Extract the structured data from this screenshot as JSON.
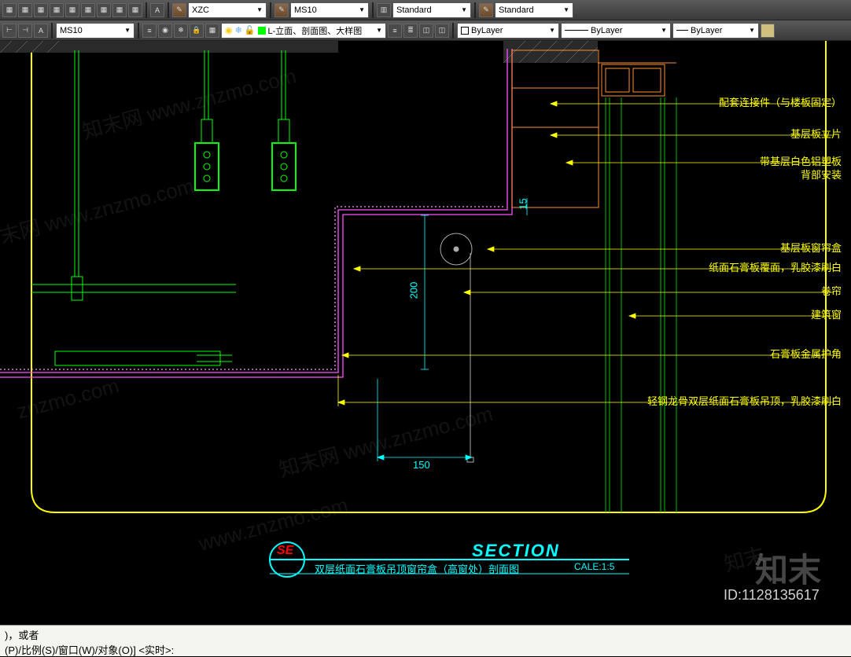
{
  "toolbar1": {
    "dropdowns": {
      "style1": "XZC",
      "style2": "MS10",
      "style3": "Standard",
      "style4": "Standard"
    }
  },
  "toolbar2": {
    "dropdowns": {
      "textstyle": "MS10",
      "layer": "L-立面、剖面图、大样图",
      "color": "ByLayer",
      "linetype": "ByLayer",
      "lineweight": "ByLayer"
    }
  },
  "annotations": [
    "配套连接件（与楼板固定）",
    "基层板立片",
    "带基层白色铝塑板",
    "背部安装",
    "基层板窗帘盒",
    "纸面石膏板覆面，乳胶漆刷白",
    "卷帘",
    "建筑窗",
    "石膏板金属护角",
    "轻钢龙骨双层纸面石膏板吊顶，乳胶漆刷白"
  ],
  "dimensions": {
    "v1": "200",
    "v2": "15",
    "h1": "150"
  },
  "section": {
    "marker": "SE",
    "heading": "SECTION",
    "title": "双层纸面石膏板吊顶窗帘盒（高窗处）剖面图",
    "scale": "CALE:1:5"
  },
  "commandline": {
    "line1": ")，或者",
    "line2": "(P)/比例(S)/窗口(W)/对象(O)] <实时>:"
  },
  "footer_id": "ID:1128135617",
  "brand": "知末"
}
